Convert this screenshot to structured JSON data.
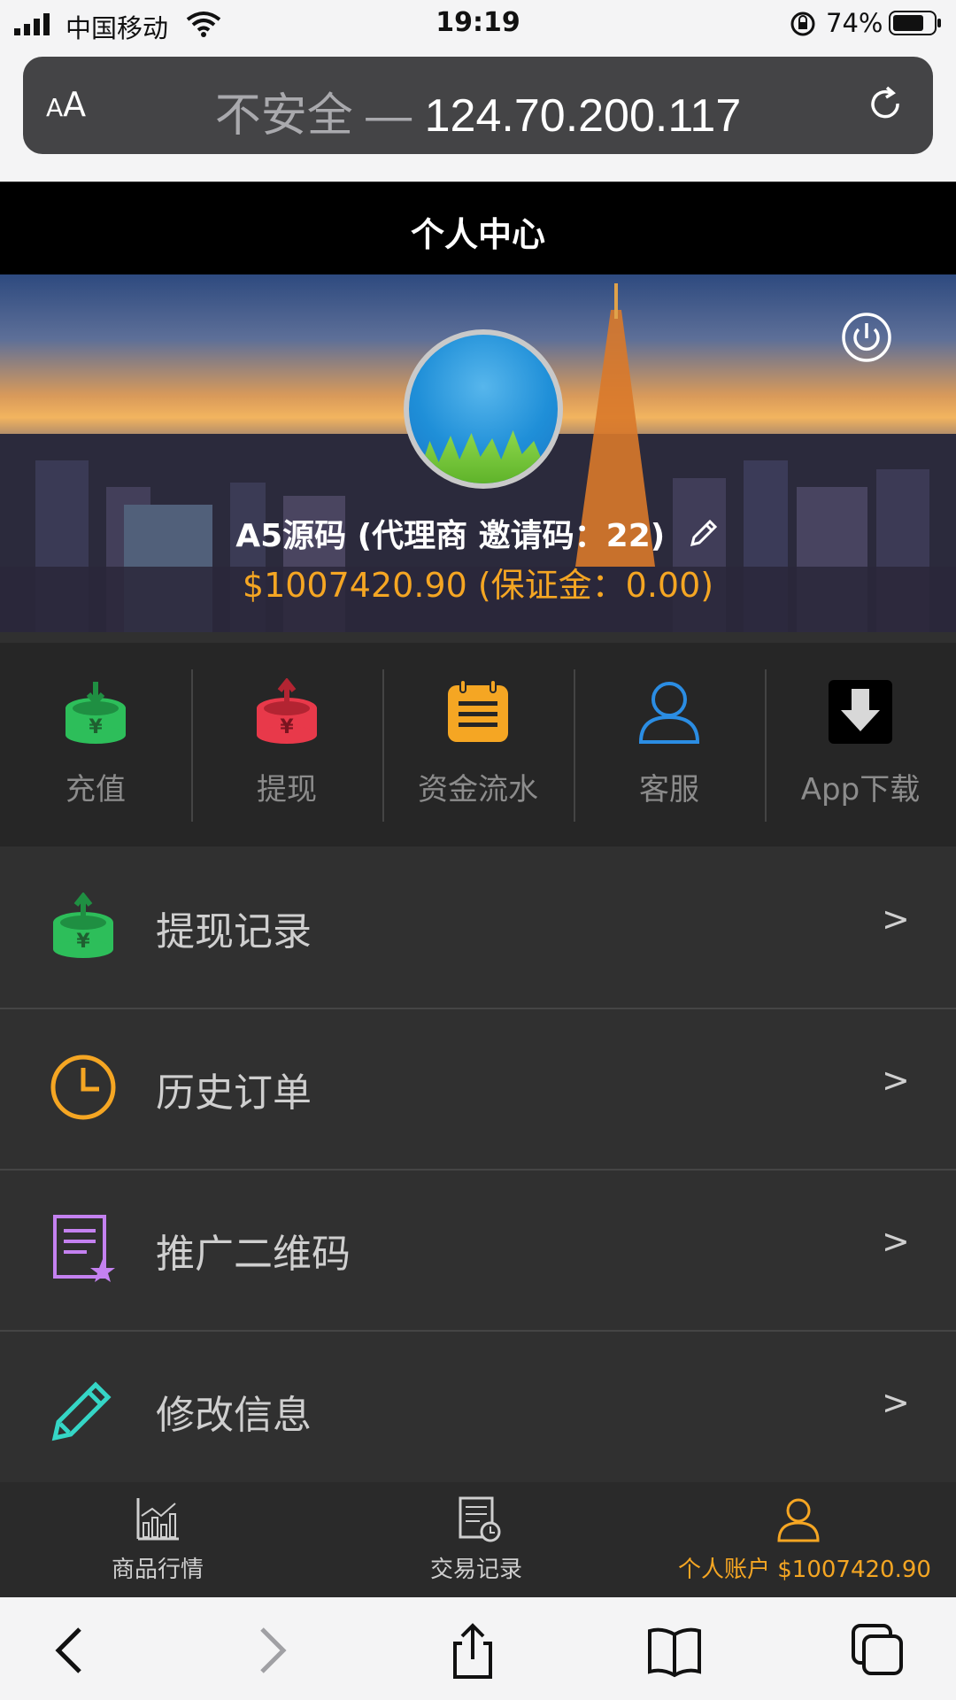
{
  "status_bar": {
    "carrier": "中国移动",
    "time": "19:19",
    "battery_percent": "74%"
  },
  "browser": {
    "text_size_label": "AA",
    "url_warning": "不安全 —",
    "url_host": "124.70.200.117"
  },
  "header": {
    "title": "个人中心"
  },
  "profile": {
    "user_line": "A5源码 (代理商 邀请码：22)",
    "balance_line": "$1007420.90 (保证金：0.00)"
  },
  "quick_actions": [
    {
      "label": "充值",
      "icon": "deposit-icon",
      "color": "#2dbe5a"
    },
    {
      "label": "提现",
      "icon": "withdraw-icon",
      "color": "#e8394a"
    },
    {
      "label": "资金流水",
      "icon": "notebook-icon",
      "color": "#f5a623"
    },
    {
      "label": "客服",
      "icon": "user-service-icon",
      "color": "#2b8de3"
    },
    {
      "label": "App下载",
      "icon": "download-icon",
      "color": "#000000"
    }
  ],
  "menu": [
    {
      "label": "提现记录",
      "icon": "withdraw-record-icon",
      "arrow": ">"
    },
    {
      "label": "历史订单",
      "icon": "clock-icon",
      "arrow": ">"
    },
    {
      "label": "推广二维码",
      "icon": "promo-document-icon",
      "arrow": ">"
    },
    {
      "label": "修改信息",
      "icon": "pencil-icon",
      "arrow": ">"
    }
  ],
  "tabs": [
    {
      "label": "商品行情",
      "icon": "market-chart-icon"
    },
    {
      "label": "交易记录",
      "icon": "trade-record-icon"
    },
    {
      "label": "个人账户 $1007420.90",
      "icon": "account-icon",
      "active": true
    }
  ],
  "colors": {
    "accent": "#f5a623",
    "header_bg": "#000000",
    "panel_bg": "#303030"
  }
}
